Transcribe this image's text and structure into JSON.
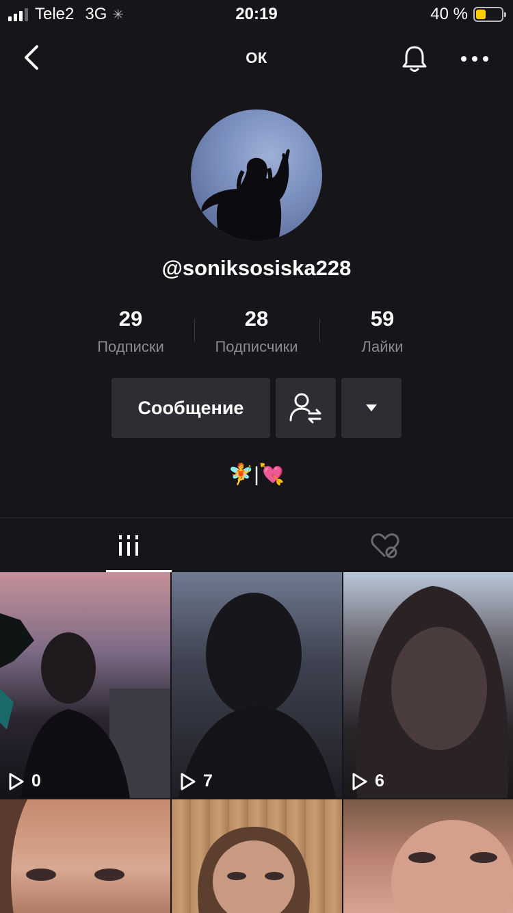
{
  "status_bar": {
    "carrier": "Tele2",
    "network": "3G",
    "time": "20:19",
    "battery": "40 %",
    "battery_level": 0.4,
    "battery_color": "#ffcc00"
  },
  "header": {
    "title": "ОК",
    "back_icon": "chevron-left-icon",
    "bell_icon": "bell-icon",
    "more_icon": "more-horizontal-icon"
  },
  "profile": {
    "username": "@soniksosiska228",
    "stats": [
      {
        "value": "29",
        "label": "Подписки"
      },
      {
        "value": "28",
        "label": "Подписчики"
      },
      {
        "value": "59",
        "label": "Лайки"
      }
    ],
    "message_button": "Сообщение",
    "bio": "🧚|💘"
  },
  "tabs": [
    {
      "icon": "grid-videos-icon",
      "active": true
    },
    {
      "icon": "liked-hidden-icon",
      "active": false
    }
  ],
  "videos": [
    {
      "views": "0"
    },
    {
      "views": "7"
    },
    {
      "views": "6"
    },
    {
      "views": ""
    },
    {
      "views": ""
    },
    {
      "views": ""
    }
  ]
}
